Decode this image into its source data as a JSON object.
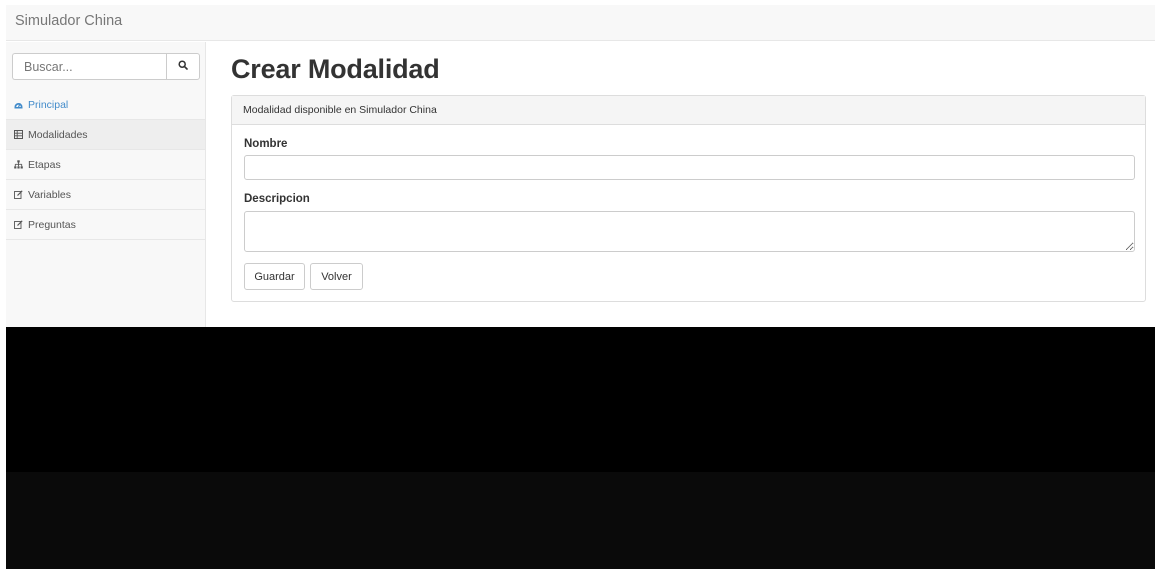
{
  "navbar": {
    "brand": "Simulador China"
  },
  "sidebar": {
    "search": {
      "placeholder": "Buscar..."
    },
    "items": [
      {
        "label": "Principal",
        "icon": "dashboard-icon",
        "state": "active"
      },
      {
        "label": "Modalidades",
        "icon": "table-icon",
        "state": "selected"
      },
      {
        "label": "Etapas",
        "icon": "sitemap-icon",
        "state": "normal"
      },
      {
        "label": "Variables",
        "icon": "edit-icon",
        "state": "normal"
      },
      {
        "label": "Preguntas",
        "icon": "edit-icon",
        "state": "normal"
      }
    ]
  },
  "main": {
    "title": "Crear Modalidad",
    "panel": {
      "heading": "Modalidad disponible en Simulador China",
      "fields": {
        "nombre": {
          "label": "Nombre",
          "value": ""
        },
        "descripcion": {
          "label": "Descripcion",
          "value": ""
        }
      },
      "buttons": {
        "save": "Guardar",
        "back": "Volver"
      }
    }
  },
  "colors": {
    "link": "#428bca",
    "navbar_bg": "#f8f8f8",
    "panel_heading_bg": "#f5f5f5"
  }
}
